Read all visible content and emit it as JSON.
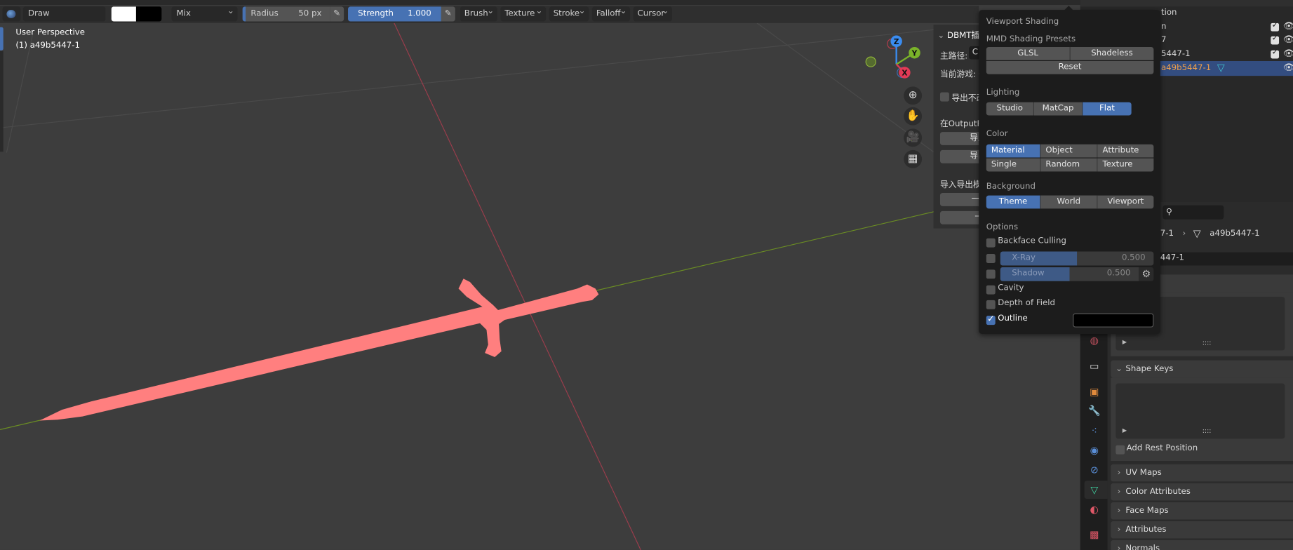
{
  "toolbar": {
    "brush_name": "Draw",
    "blend_mode": "Mix",
    "radius_label": "Radius",
    "radius_value": "50 px",
    "strength_label": "Strength",
    "strength_value": "1.000",
    "strength_fraction": 1.0,
    "menus": [
      "Brush",
      "Texture",
      "Stroke",
      "Falloff",
      "Cursor"
    ],
    "primary_color": "#ffffff",
    "secondary_color": "#000000"
  },
  "viewport": {
    "view_name": "User Perspective",
    "object_label": "(1) a49b5447-1",
    "mesh_color": "#ff7f7f",
    "gizmo": {
      "x": "X",
      "y": "Y",
      "z": "Z"
    }
  },
  "dbmt_panel": {
    "title": "DBMT插",
    "main_path_label": "主路径:",
    "main_path_value": "C",
    "current_game": "当前游戏: C",
    "export_checkbox": "导出不改",
    "output_label": "在OutputFo",
    "import_button": "导入 .",
    "export_button": "导出 .",
    "io_label": "导入导出模",
    "one_key_1": "一键导",
    "one_key_2": "一键"
  },
  "shading_popup": {
    "title": "Viewport Shading",
    "presets_label": "MMD Shading Presets",
    "presets": [
      "GLSL",
      "Shadeless"
    ],
    "reset": "Reset",
    "lighting_label": "Lighting",
    "lighting": [
      "Studio",
      "MatCap",
      "Flat"
    ],
    "lighting_active": "Flat",
    "color_label": "Color",
    "color_options": [
      "Material",
      "Object",
      "Attribute",
      "Single",
      "Random",
      "Texture"
    ],
    "color_active": "Material",
    "background_label": "Background",
    "background": [
      "Theme",
      "World",
      "Viewport"
    ],
    "background_active": "Theme",
    "options_label": "Options",
    "backface_culling": "Backface Culling",
    "xray_label": "X-Ray",
    "xray_value": "0.500",
    "xray_fraction": 0.5,
    "shadow_label": "Shadow",
    "shadow_value": "0.500",
    "shadow_fraction": 0.5,
    "cavity": "Cavity",
    "depth_of_field": "Depth of Field",
    "outline": "Outline",
    "outline_checked": true,
    "outline_color": "#000000"
  },
  "outliner": {
    "rows": [
      "tion",
      "n",
      "7",
      "5447-1",
      "a49b5447-1"
    ]
  },
  "properties": {
    "breadcrumb_parent": "7-1",
    "breadcrumb_mesh": "a49b5447-1",
    "name_field": "447-1",
    "vertex_groups": "oups",
    "shape_keys": "Shape Keys",
    "add_rest_position": "Add Rest Position",
    "panels": [
      "UV Maps",
      "Color Attributes",
      "Face Maps",
      "Attributes",
      "Normals"
    ],
    "list_handle": "::::"
  }
}
